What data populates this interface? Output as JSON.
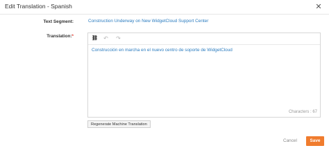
{
  "dialog": {
    "title": "Edit Translation - Spanish",
    "close_icon": "close-icon",
    "close_glyph": "✕"
  },
  "form": {
    "segment_label": "Text Segment:",
    "segment_value": "Construction Underway on New WidgetCloud Support Center",
    "translation_label": "Translation:",
    "required_marker": "*"
  },
  "editor": {
    "toolbar": [
      {
        "icon": "link-icon",
        "glyph": "⛓",
        "enabled": true
      },
      {
        "icon": "undo-icon",
        "glyph": "↶",
        "enabled": false
      },
      {
        "icon": "redo-icon",
        "glyph": "↷",
        "enabled": false
      }
    ],
    "text": "Construcción en marcha en el nuevo centro de soporte de WidgetCloud",
    "char_count": "Characters : 67"
  },
  "actions": {
    "regenerate_label": "Regenerate Machine Translation",
    "cancel_label": "Cancel",
    "save_label": "Save"
  },
  "colors": {
    "link": "#2a7bbf",
    "save_button": "#f07c2e",
    "required": "#e0362b"
  }
}
